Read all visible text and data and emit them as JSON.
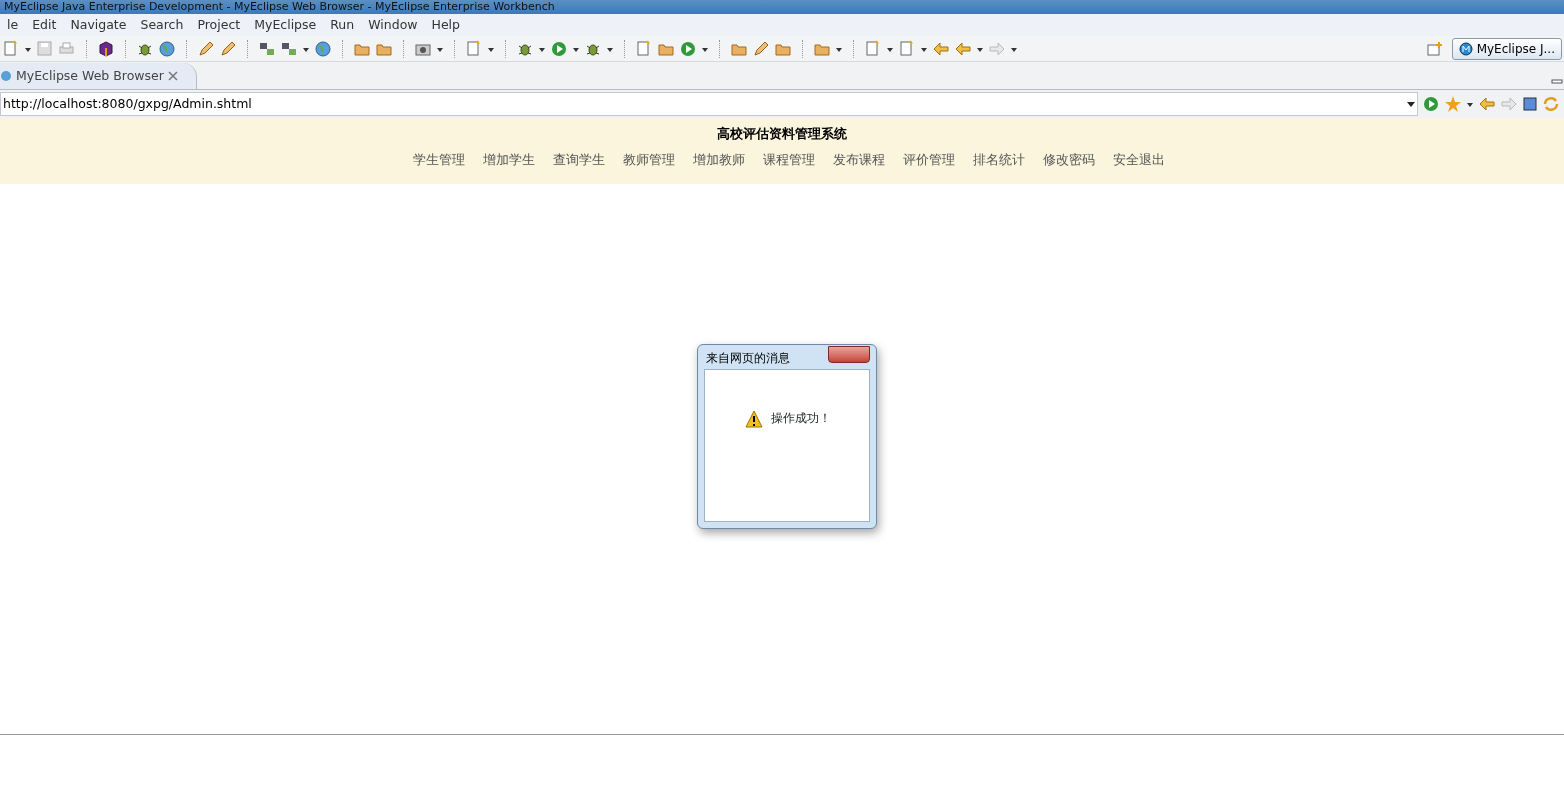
{
  "window": {
    "title": "MyEclipse Java Enterprise Development - MyEclipse Web Browser - MyEclipse Enterprise Workbench"
  },
  "menu": [
    "le",
    "Edit",
    "Navigate",
    "Search",
    "Project",
    "MyEclipse",
    "Run",
    "Window",
    "Help"
  ],
  "perspective": {
    "label": "MyEclipse J..."
  },
  "editor_tab": {
    "label": "MyEclipse Web Browser",
    "selected": true
  },
  "browser": {
    "url": "http://localhost:8080/gxpg/Admin.shtml"
  },
  "page": {
    "title": "高校评估资料管理系统",
    "nav": [
      "学生管理",
      "增加学生",
      "查询学生",
      "教师管理",
      "增加教师",
      "课程管理",
      "发布课程",
      "评价管理",
      "排名统计",
      "修改密码",
      "安全退出"
    ]
  },
  "dialog": {
    "title": "来自网页的消息",
    "message": "操作成功！"
  }
}
